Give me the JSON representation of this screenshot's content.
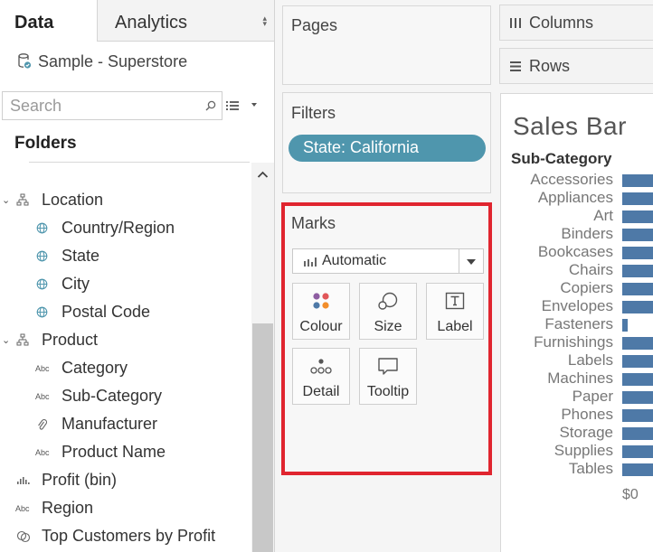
{
  "tabs": {
    "data": "Data",
    "analytics": "Analytics"
  },
  "datasource": {
    "name": "Sample - Superstore"
  },
  "search": {
    "placeholder": "Search"
  },
  "folders_label": "Folders",
  "fields": [
    {
      "label": "Location",
      "icon": "hierarchy-icon",
      "level": 0,
      "expanded": true
    },
    {
      "label": "Country/Region",
      "icon": "globe-icon",
      "level": 1
    },
    {
      "label": "State",
      "icon": "globe-icon",
      "level": 1
    },
    {
      "label": "City",
      "icon": "globe-icon",
      "level": 1
    },
    {
      "label": "Postal Code",
      "icon": "globe-icon",
      "level": 1
    },
    {
      "label": "Product",
      "icon": "hierarchy-icon",
      "level": 0,
      "expanded": true
    },
    {
      "label": "Category",
      "icon": "abc-icon",
      "level": 1
    },
    {
      "label": "Sub-Category",
      "icon": "abc-icon",
      "level": 1
    },
    {
      "label": "Manufacturer",
      "icon": "paperclip-icon",
      "level": 1
    },
    {
      "label": "Product Name",
      "icon": "abc-icon",
      "level": 1
    },
    {
      "label": "Profit (bin)",
      "icon": "bin-histogram-icon",
      "level": 0
    },
    {
      "label": "Region",
      "icon": "abc-icon",
      "level": 0
    },
    {
      "label": "Top Customers by Profit",
      "icon": "set-icon",
      "level": 0
    }
  ],
  "shelves": {
    "pages": "Pages",
    "filters": "Filters",
    "filter_pill": "State: California",
    "marks": "Marks",
    "mark_type": "Automatic",
    "mark_buttons": [
      "Colour",
      "Size",
      "Label",
      "Detail",
      "Tooltip"
    ],
    "columns": "Columns",
    "rows": "Rows"
  },
  "view": {
    "title": "Sales Bar",
    "header": "Sub-Category",
    "axis_start": "$0",
    "bar_color": "#4e79a7",
    "categories": [
      "Accessories",
      "Appliances",
      "Art",
      "Binders",
      "Bookcases",
      "Chairs",
      "Copiers",
      "Envelopes",
      "Fasteners",
      "Furnishings",
      "Labels",
      "Machines",
      "Paper",
      "Phones",
      "Storage",
      "Supplies",
      "Tables"
    ],
    "bar_fills": [
      1,
      1,
      1,
      1,
      1,
      1,
      1,
      1,
      0.14,
      1,
      1,
      1,
      1,
      1,
      1,
      1,
      1
    ]
  },
  "colors": {
    "accent_pill": "#4f96ad",
    "highlight": "#e0252f"
  }
}
